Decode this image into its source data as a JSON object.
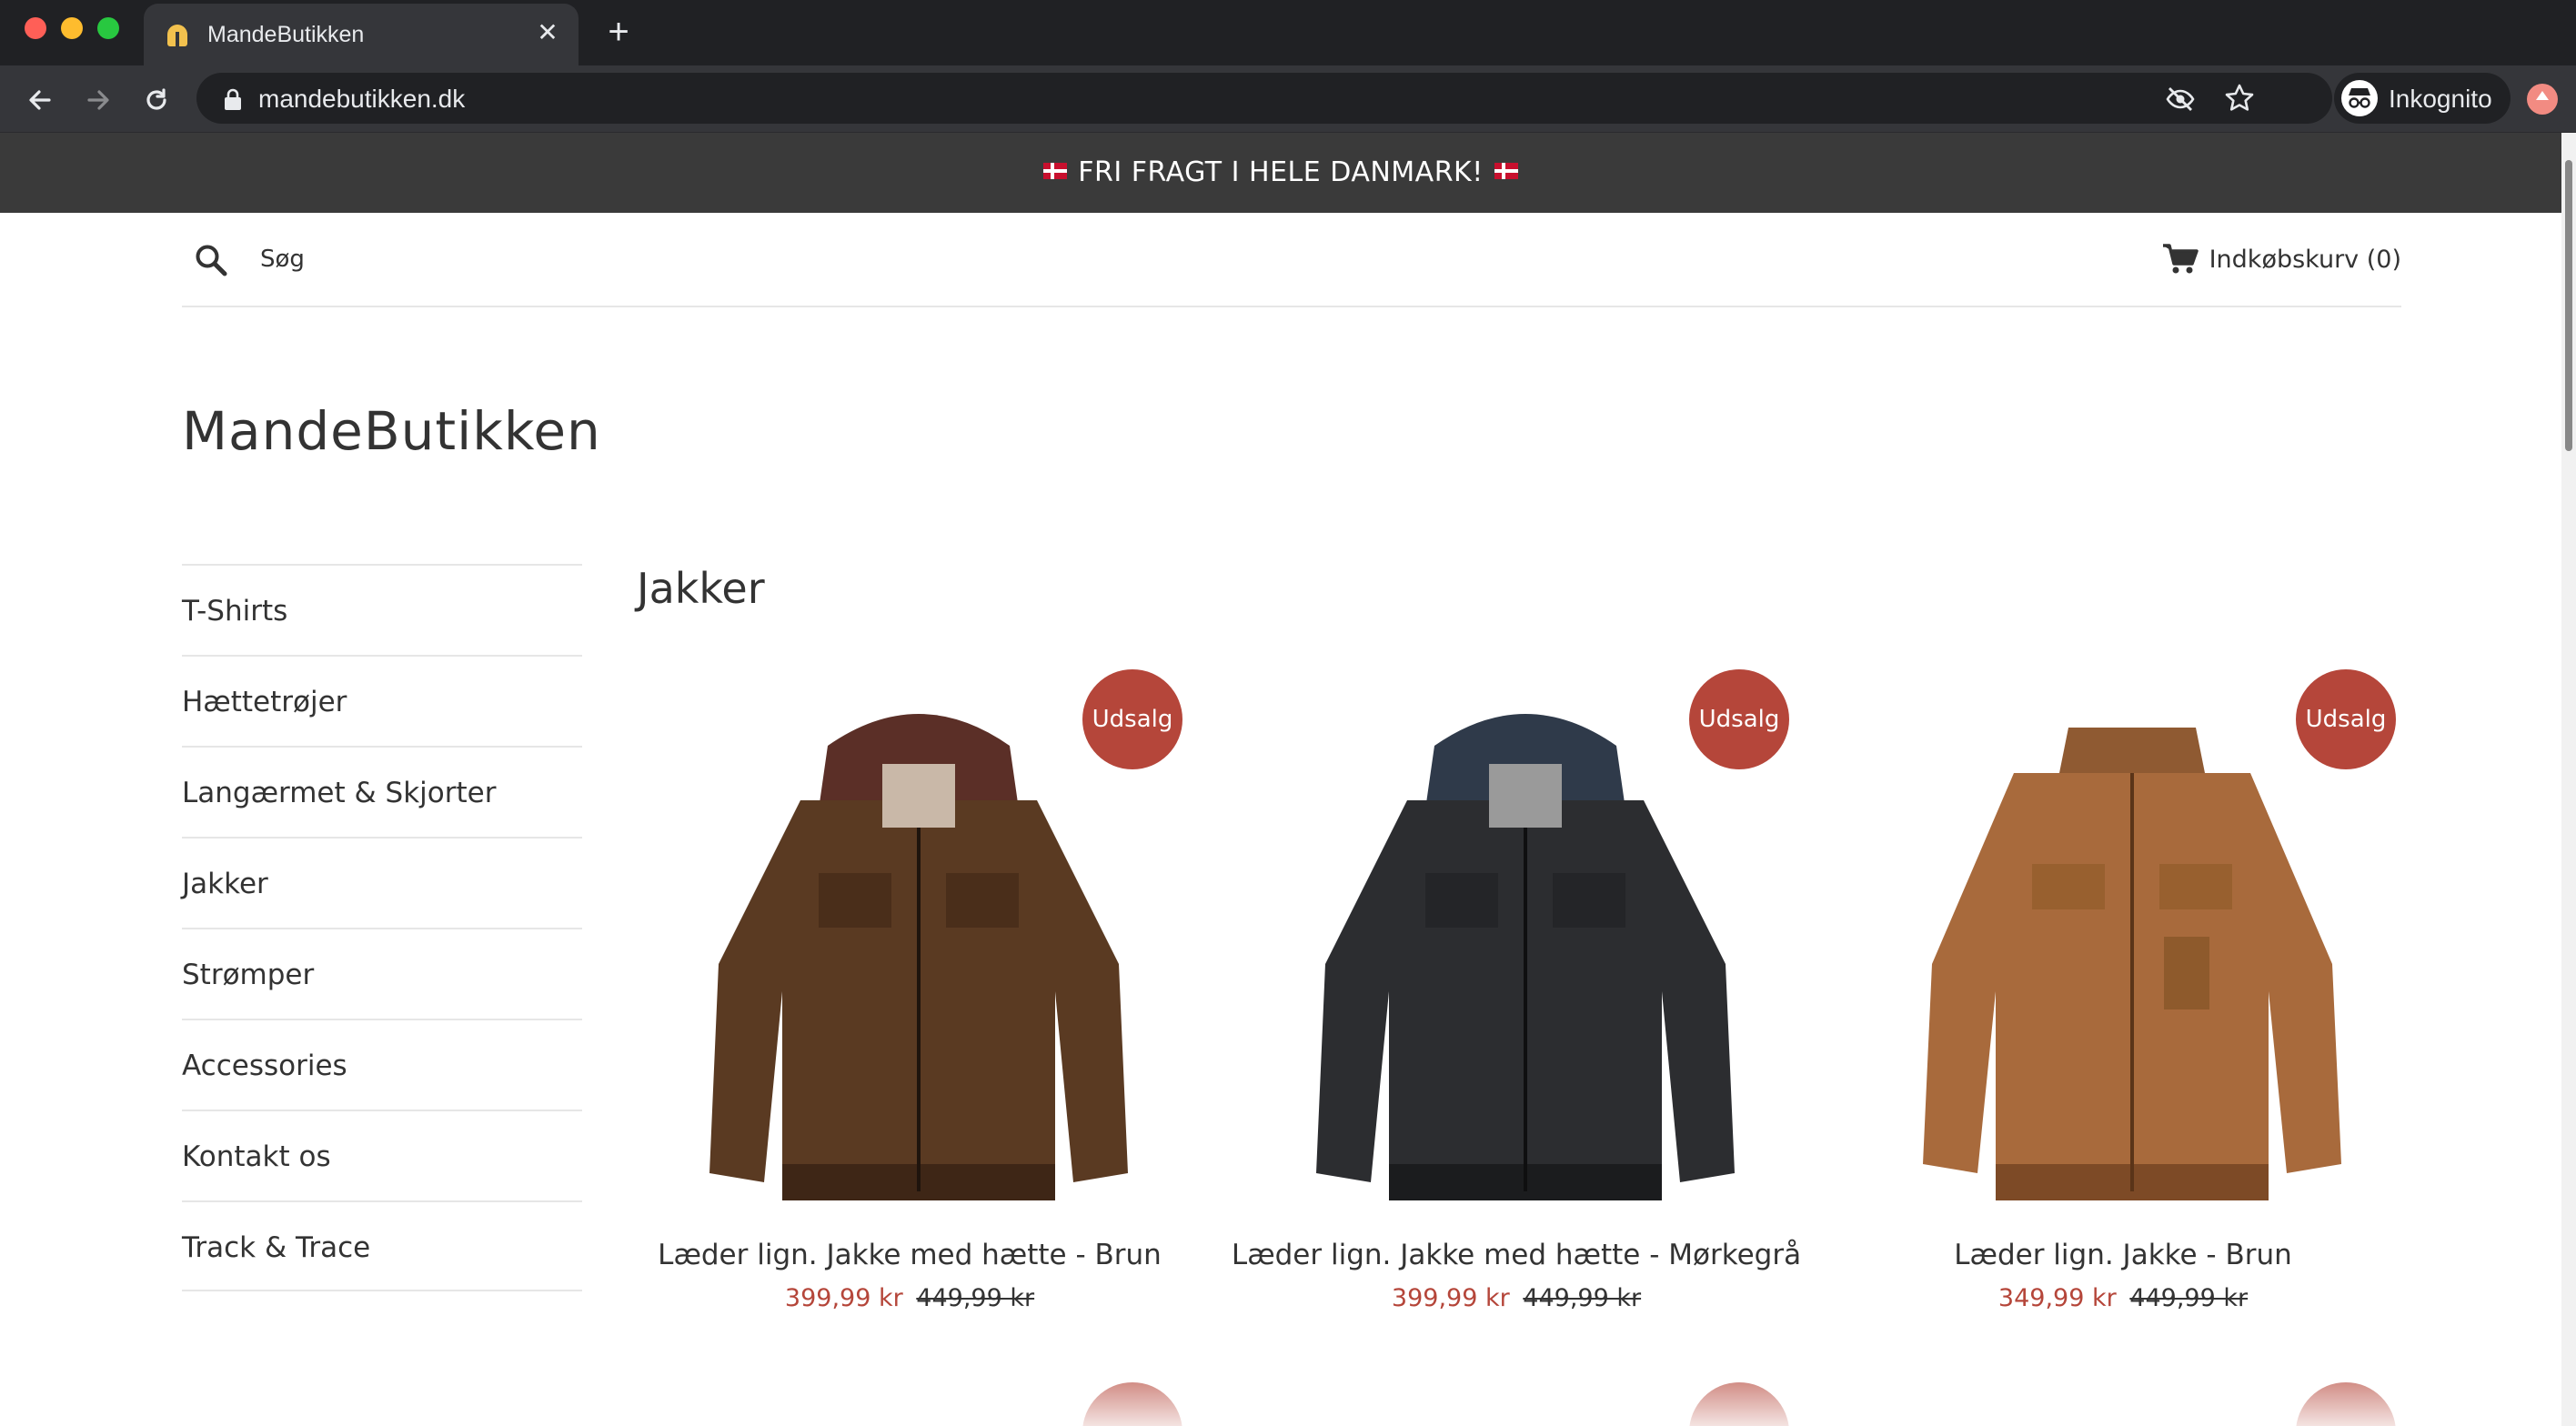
{
  "browser": {
    "tab_title": "MandeButikken",
    "url": "mandebutikken.dk",
    "profile_label": "Inkognito"
  },
  "store": {
    "announcement": "FRI FRAGT I HELE DANMARK!",
    "search_label": "Søg",
    "cart_label": "Indkøbskurv (0)",
    "logo": "MandeButikken"
  },
  "sidebar": {
    "items": [
      {
        "label": "T-Shirts"
      },
      {
        "label": "Hættetrøjer"
      },
      {
        "label": "Langærmet & Skjorter"
      },
      {
        "label": "Jakker"
      },
      {
        "label": "Strømper"
      },
      {
        "label": "Accessories"
      },
      {
        "label": "Kontakt os"
      },
      {
        "label": "Track & Trace"
      }
    ]
  },
  "collection": {
    "title": "Jakker",
    "products": [
      {
        "name": "Læder lign. Jakke med hætte - Brun",
        "badge": "Udsalg",
        "sale_price": "399,99 kr",
        "original_price": "449,99 kr",
        "color": "#5a3a22",
        "hood": "#5b2f27"
      },
      {
        "name": "Læder lign. Jakke med hætte - Mørkegrå",
        "badge": "Udsalg",
        "sale_price": "399,99 kr",
        "original_price": "449,99 kr",
        "color": "#2c2d30",
        "hood": "#2f3a4a"
      },
      {
        "name": "Læder lign. Jakke - Brun",
        "badge": "Udsalg",
        "sale_price": "349,99 kr",
        "original_price": "449,99 kr",
        "color": "#a86a3c",
        "hood": ""
      }
    ]
  },
  "colors": {
    "sale": "#b5463a",
    "announcement_bg": "#3a3a3a",
    "browser_dark": "#202124"
  }
}
